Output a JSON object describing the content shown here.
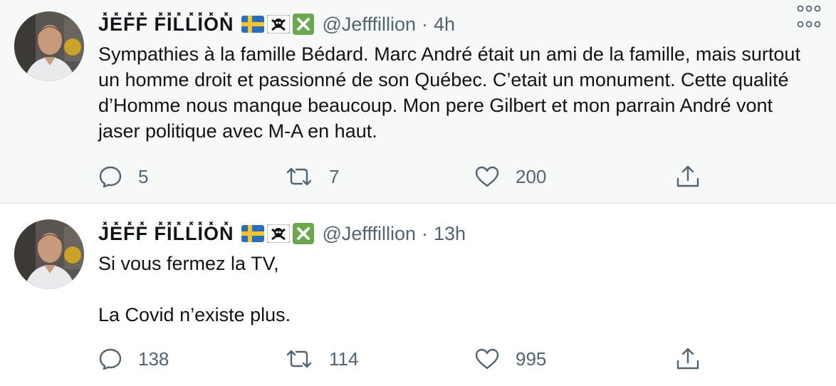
{
  "tweets": [
    {
      "display_name": "J̽E̽F̽F̽ F̽I̽L̽L̽I̽O̽N̽",
      "flags": [
        "sweden-flag",
        "skull-crossbones-icon",
        "cross-mark-icon"
      ],
      "handle": "@Jefffillion",
      "separator": "·",
      "time": "4h",
      "text": [
        "Sympathies à la famille Bédard. Marc André était un ami de la famille, mais surtout un homme droit et passionné de son Québec. C’etait un monument. Cette qualité d’Homme nous manque beaucoup. Mon pere Gilbert et mon parrain André vont jaser politique avec M-A en haut."
      ],
      "replies": "5",
      "retweets": "7",
      "likes": "200"
    },
    {
      "display_name": "J̽E̽F̽F̽ F̽I̽L̽L̽I̽O̽N̽",
      "flags": [
        "sweden-flag",
        "skull-crossbones-icon",
        "cross-mark-icon"
      ],
      "handle": "@Jefffillion",
      "separator": "·",
      "time": "13h",
      "text": [
        "Si vous fermez la TV,",
        "La Covid n’existe plus."
      ],
      "replies": "138",
      "retweets": "114",
      "likes": "995"
    }
  ],
  "colors": {
    "text_primary": "#0f1419",
    "text_secondary": "#536471",
    "highlight_bg": "#f7f9f9",
    "divider": "#e6ecf0"
  }
}
